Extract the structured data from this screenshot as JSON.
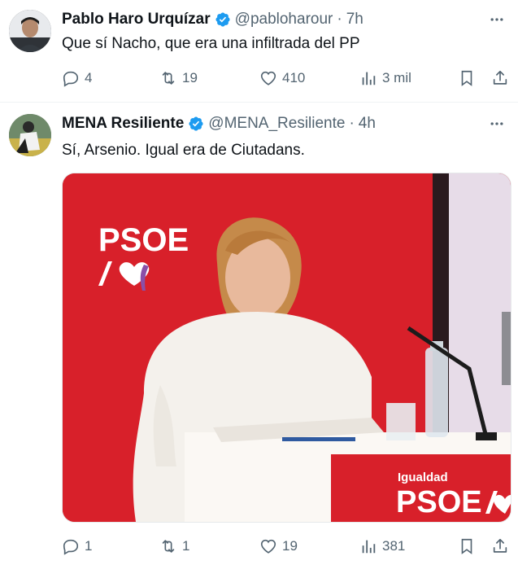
{
  "tweets": [
    {
      "name": "Pablo Haro Urquízar",
      "handle": "@pabloharour",
      "separator": "·",
      "time": "7h",
      "text": "Que sí Nacho, que era una infiltrada del PP",
      "stats": {
        "replies": "4",
        "retweets": "19",
        "likes": "410",
        "views": "3 mil"
      }
    },
    {
      "name": "MENA Resiliente",
      "handle": "@MENA_Resiliente",
      "separator": "·",
      "time": "4h",
      "text": "Sí, Arsenio. Igual era de Ciutadans.",
      "stats": {
        "replies": "1",
        "retweets": "1",
        "likes": "19",
        "views": "381"
      },
      "media": {
        "sign_left": "PSOE",
        "sign_bottom_small": "Igualdad",
        "sign_bottom_big": "PSOE"
      }
    }
  ],
  "colors": {
    "verified": "#1d9bf0",
    "muted": "#536471",
    "psoe_red": "#d8202a"
  },
  "icons": {
    "reply": "reply-icon",
    "retweet": "retweet-icon",
    "like": "heart-icon",
    "views": "views-chart-icon",
    "bookmark": "bookmark-icon",
    "share": "share-icon",
    "more": "more-dots-icon",
    "verified": "verified-badge-icon"
  }
}
